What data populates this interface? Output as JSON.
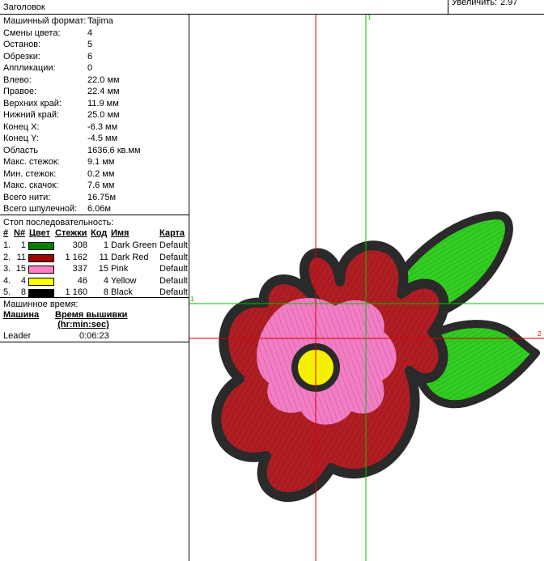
{
  "window": {
    "title": "Заголовок",
    "zoom_label": "Увеличить:",
    "zoom_value": "2.97"
  },
  "properties": [
    {
      "key": "Машинный формат:",
      "value": "Tajima"
    },
    {
      "key": "Смены цвета:",
      "value": "4"
    },
    {
      "key": "Останов:",
      "value": "5"
    },
    {
      "key": "Обрезки:",
      "value": "6"
    },
    {
      "key": "Аппликации:",
      "value": "0"
    },
    {
      "key": "Влево:",
      "value": "22.0 мм"
    },
    {
      "key": "Правое:",
      "value": "22.4 мм"
    },
    {
      "key": "Верхних край:",
      "value": "11.9 мм"
    },
    {
      "key": "Нижний край:",
      "value": "25.0 мм"
    },
    {
      "key": "Конец X:",
      "value": "-6.3 мм"
    },
    {
      "key": "Конец Y:",
      "value": "-4.5 мм"
    },
    {
      "key": "Область",
      "value": "1636.6 кв.мм"
    },
    {
      "key": "Макс. стежок:",
      "value": "9.1 мм"
    },
    {
      "key": "Мин. стежок:",
      "value": "0.2 мм"
    },
    {
      "key": "Макс. скачок:",
      "value": "7.6 мм"
    },
    {
      "key": "Всего нити:",
      "value": "16.75м"
    },
    {
      "key": "Всего шпулечной:",
      "value": "6.06м"
    }
  ],
  "stop_sequence": {
    "title": "Стоп последовательность:",
    "headers": {
      "num": "#",
      "n": "N#",
      "color": "Цвет",
      "stitches": "Стежки",
      "code": "Код",
      "name": "Имя",
      "chart": "Карта"
    },
    "rows": [
      {
        "num": "1.",
        "n": "1",
        "color": "#008000",
        "stitches": "308",
        "code": "1",
        "name": "Dark Green",
        "chart": "Default"
      },
      {
        "num": "2.",
        "n": "11",
        "color": "#a00000",
        "stitches": "1 162",
        "code": "11",
        "name": "Dark Red",
        "chart": "Default"
      },
      {
        "num": "3.",
        "n": "15",
        "color": "#ff80c0",
        "stitches": "337",
        "code": "15",
        "name": "Pink",
        "chart": "Default"
      },
      {
        "num": "4.",
        "n": "4",
        "color": "#ffff00",
        "stitches": "46",
        "code": "4",
        "name": "Yellow",
        "chart": "Default"
      },
      {
        "num": "5.",
        "n": "8",
        "color": "#000000",
        "stitches": "1 160",
        "code": "8",
        "name": "Black",
        "chart": "Default"
      }
    ]
  },
  "machine_time": {
    "title": "Машинное время:",
    "col_machine": "Машина",
    "col_time_line1": "Время вышивки",
    "col_time_line2": "(hr:min:sec)",
    "rows": [
      {
        "machine": "Leader",
        "time": "0:06:23"
      }
    ]
  },
  "canvas": {
    "guide_label_1": "1",
    "guide_label_2": "2",
    "colors": {
      "red_guide": "#e00000",
      "green_guide": "#00c000",
      "outline": "#2a2a2a",
      "petal_red": "#b01e24",
      "pink": "#f27fc4",
      "yellow": "#f5f000",
      "leaf_green": "#33cc22"
    }
  }
}
